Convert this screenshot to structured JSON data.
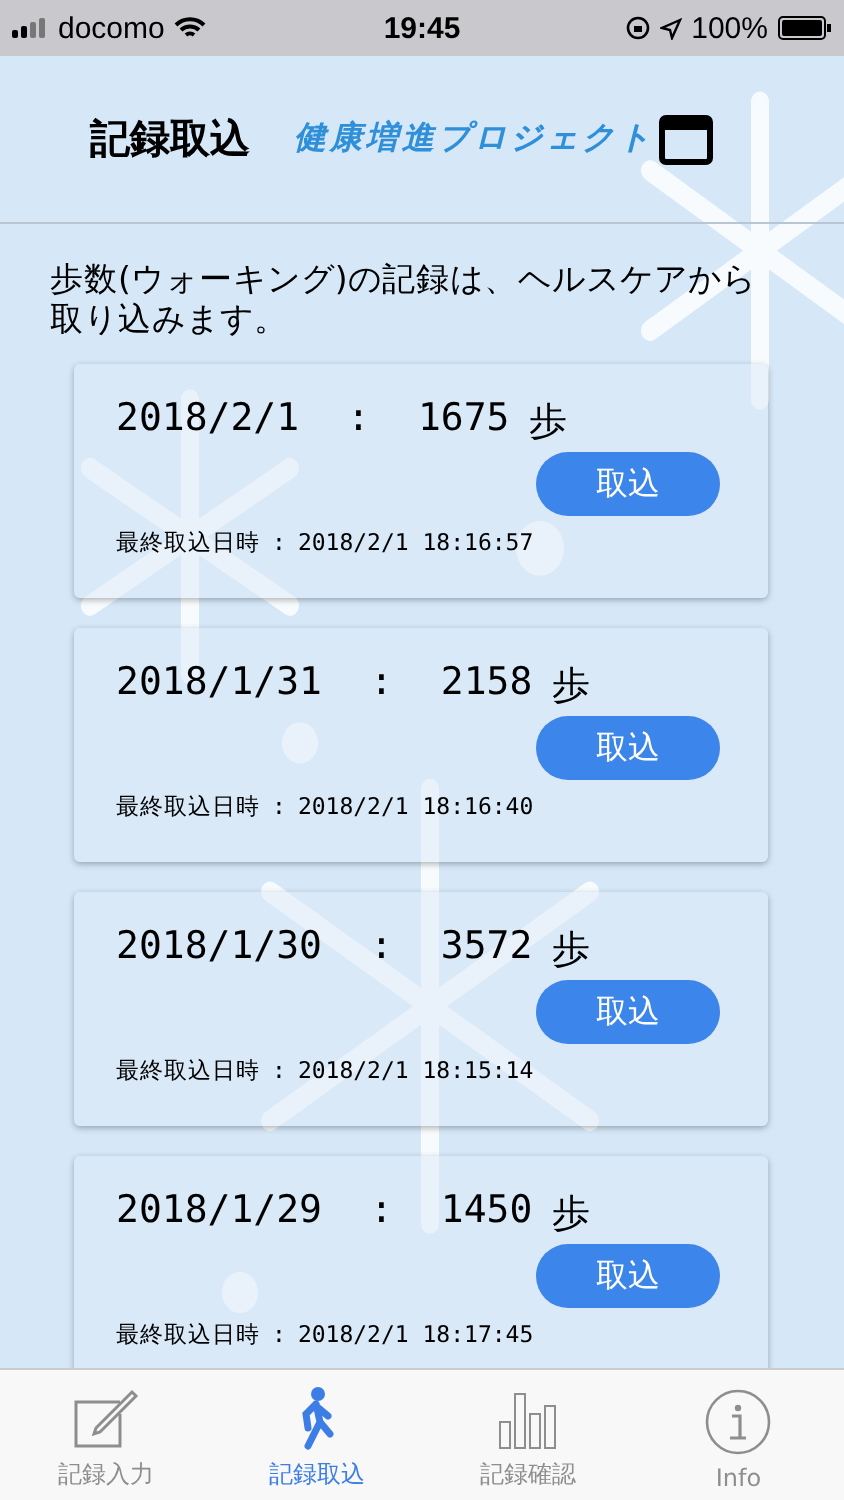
{
  "status_bar": {
    "carrier": "docomo",
    "time": "19:45",
    "battery": "100%"
  },
  "header": {
    "title": "記録取込",
    "project": "健康増進プロジェクト"
  },
  "intro": "歩数(ウォーキング)の記録は、ヘルスケアから取り込みます。",
  "records": [
    {
      "date": "2018/2/1",
      "separator": ":",
      "steps": "1675",
      "unit": "歩",
      "button": "取込",
      "last_label": "最終取込日時",
      "last_sep": ":",
      "last_time": "2018/2/1 18:16:57"
    },
    {
      "date": "2018/1/31",
      "separator": ":",
      "steps": "2158",
      "unit": "歩",
      "button": "取込",
      "last_label": "最終取込日時",
      "last_sep": ":",
      "last_time": "2018/2/1 18:16:40"
    },
    {
      "date": "2018/1/30",
      "separator": ":",
      "steps": "3572",
      "unit": "歩",
      "button": "取込",
      "last_label": "最終取込日時",
      "last_sep": ":",
      "last_time": "2018/2/1 18:15:14"
    },
    {
      "date": "2018/1/29",
      "separator": ":",
      "steps": "1450",
      "unit": "歩",
      "button": "取込",
      "last_label": "最終取込日時",
      "last_sep": ":",
      "last_time": "2018/2/1 18:17:45"
    }
  ],
  "tabs": [
    {
      "label": "記録入力",
      "kind": "edit",
      "selected": false
    },
    {
      "label": "記録取込",
      "kind": "walk",
      "selected": true
    },
    {
      "label": "記録確認",
      "kind": "chart",
      "selected": false
    },
    {
      "label": "Info",
      "kind": "info",
      "selected": false
    }
  ]
}
